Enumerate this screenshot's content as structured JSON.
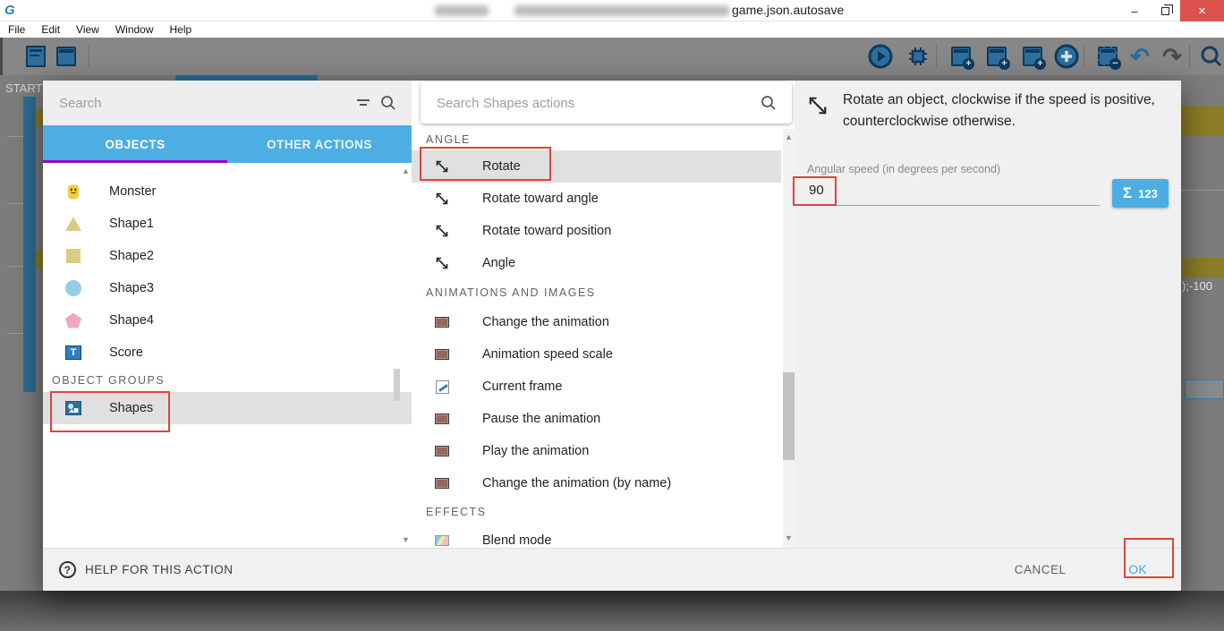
{
  "window": {
    "title_tail": "game.json.autosave",
    "controls": [
      "minimize-icon",
      "restore-icon",
      "close-icon"
    ]
  },
  "menubar": {
    "items": [
      "File",
      "Edit",
      "View",
      "Window",
      "Help"
    ]
  },
  "toolbar": {
    "left_icons": [
      "project-manager-icon",
      "scene-editor-icon"
    ],
    "right_icons": [
      "play-icon",
      "debug-icon",
      "add-sub-event-icon",
      "add-event-icon",
      "add-comment-icon",
      "add-circle-icon",
      "delete-event-icon",
      "undo-icon",
      "redo-icon",
      "search-icon"
    ],
    "undo_glyph": "↶",
    "redo_glyph": "↷"
  },
  "background": {
    "scene_tab": "START",
    "expression_snippet": ");-100"
  },
  "dialog": {
    "left": {
      "search_placeholder": "Search",
      "tabs": [
        {
          "label": "OBJECTS"
        },
        {
          "label": "OTHER ACTIONS"
        }
      ],
      "objects": [
        {
          "label": "Monster"
        },
        {
          "label": "Shape1"
        },
        {
          "label": "Shape2"
        },
        {
          "label": "Shape3"
        },
        {
          "label": "Shape4"
        },
        {
          "label": "Score"
        }
      ],
      "groups_header": "OBJECT GROUPS",
      "groups": [
        {
          "label": "Shapes",
          "selected": true
        }
      ]
    },
    "middle": {
      "search_placeholder": "Search Shapes actions",
      "sections": [
        {
          "header": "ANGLE",
          "items": [
            {
              "label": "Rotate",
              "selected": true
            },
            {
              "label": "Rotate toward angle"
            },
            {
              "label": "Rotate toward position"
            },
            {
              "label": "Angle"
            }
          ]
        },
        {
          "header": "ANIMATIONS AND IMAGES",
          "items": [
            {
              "label": "Change the animation"
            },
            {
              "label": "Animation speed scale"
            },
            {
              "label": "Current frame"
            },
            {
              "label": "Pause the animation"
            },
            {
              "label": "Play the animation"
            },
            {
              "label": "Change the animation (by name)"
            }
          ]
        },
        {
          "header": "EFFECTS",
          "items": [
            {
              "label": "Blend mode"
            }
          ]
        }
      ]
    },
    "right": {
      "description": "Rotate an object, clockwise if the speed is positive, counterclockwise otherwise.",
      "field_label": "Angular speed (in degrees per second)",
      "field_value": "90",
      "expression_button": {
        "sigma": "Σ",
        "digits": "123"
      }
    },
    "footer": {
      "help": "HELP FOR THIS ACTION",
      "cancel": "CANCEL",
      "ok": "OK"
    }
  },
  "colors": {
    "accent_blue": "#4daee3",
    "tab_underline_purple": "#9a00c9",
    "selection_gray": "#e0e0e0",
    "annotation_red": "#dc4639",
    "ok_text_blue": "#4d9fe0",
    "close_button_red": "#dd524c"
  }
}
